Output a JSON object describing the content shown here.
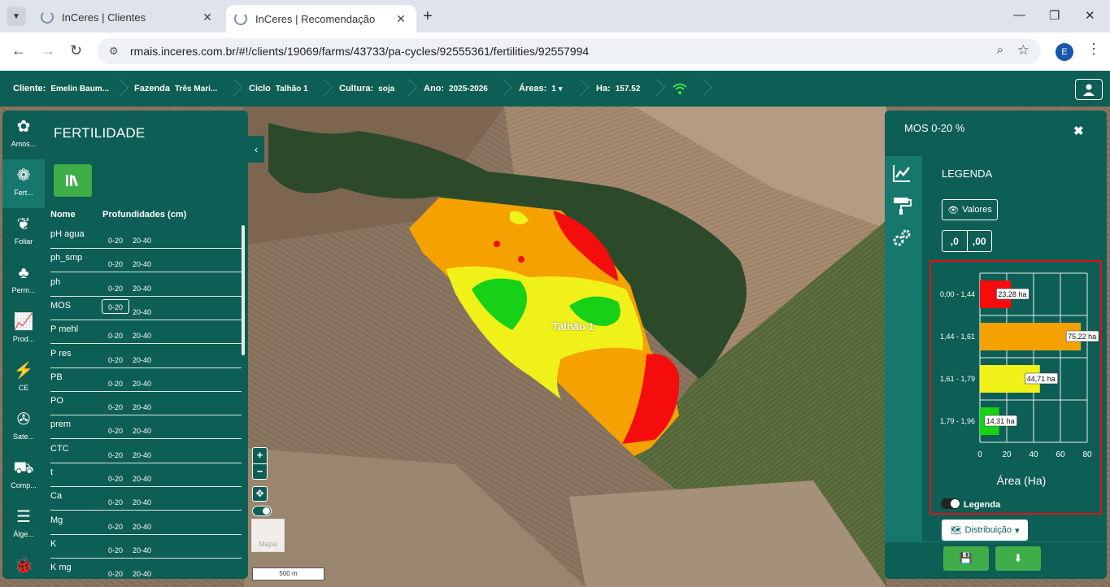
{
  "browser": {
    "tabs": [
      {
        "title": "InCeres | Clientes",
        "close": "✕"
      },
      {
        "title": "InCeres | Recomendação",
        "close": "✕"
      }
    ],
    "new_tab": "+",
    "url": "rmais.inceres.com.br/#!/clients/19069/farms/43733/pa-cycles/92555361/fertilities/92557994",
    "profile_initial": "E"
  },
  "header": {
    "cliente_label": "Cliente:",
    "cliente_value": "Emelin Baum...",
    "fazenda_label": "Fazenda",
    "fazenda_value": "Três Mari...",
    "ciclo_label": "Ciclo",
    "ciclo_value": "Talhão 1",
    "cultura_label": "Cultura:",
    "cultura_value": "soja",
    "ano_label": "Ano:",
    "ano_value": "2025-2026",
    "areas_label": "Áreas:",
    "areas_value": "1",
    "ha_label": "Ha:",
    "ha_value": "157.52"
  },
  "rail": [
    {
      "label": "Amos...",
      "icon": "samples-icon"
    },
    {
      "label": "Fert...",
      "icon": "fertility-icon"
    },
    {
      "label": "Foliar",
      "icon": "leaf-icon"
    },
    {
      "label": "Perm...",
      "icon": "permanent-crop-icon"
    },
    {
      "label": "Prod...",
      "icon": "productivity-icon"
    },
    {
      "label": "CE",
      "icon": "ce-icon"
    },
    {
      "label": "Sate...",
      "icon": "satellite-icon"
    },
    {
      "label": "Comp...",
      "icon": "composition-icon"
    },
    {
      "label": "Álge...",
      "icon": "layers-icon"
    },
    {
      "label": "",
      "icon": "bug-icon"
    }
  ],
  "fertility": {
    "title": "FERTILIDADE",
    "col_name": "Nome",
    "col_depth": "Profundidades (cm)",
    "rows": [
      {
        "name": "pH agua",
        "d1": "0-20",
        "d2": "20-40"
      },
      {
        "name": "ph_smp",
        "d1": "0-20",
        "d2": "20-40"
      },
      {
        "name": "ph",
        "d1": "0-20",
        "d2": "20-40"
      },
      {
        "name": "MOS",
        "d1": "0-20",
        "d2": "20-40"
      },
      {
        "name": "P mehl",
        "d1": "0-20",
        "d2": "20-40"
      },
      {
        "name": "P res",
        "d1": "0-20",
        "d2": "20-40"
      },
      {
        "name": "PB",
        "d1": "0-20",
        "d2": "20-40"
      },
      {
        "name": "PO",
        "d1": "0-20",
        "d2": "20-40"
      },
      {
        "name": "prem",
        "d1": "0-20",
        "d2": "20-40"
      },
      {
        "name": "CTC",
        "d1": "0-20",
        "d2": "20-40"
      },
      {
        "name": "t",
        "d1": "0-20",
        "d2": "20-40"
      },
      {
        "name": "Ca",
        "d1": "0-20",
        "d2": "20-40"
      },
      {
        "name": "Mg",
        "d1": "0-20",
        "d2": "20-40"
      },
      {
        "name": "K",
        "d1": "0-20",
        "d2": "20-40"
      },
      {
        "name": "K mg",
        "d1": "0-20",
        "d2": "20-40"
      }
    ]
  },
  "map": {
    "field_label": "Talhão 1",
    "zoom_in": "+",
    "zoom_out": "−",
    "basemap_label": "Mapa",
    "scale": "500 m"
  },
  "right_panel": {
    "title": "MOS 0-20 %",
    "legend_title": "LEGENDA",
    "valores_label": "Valores",
    "decimals_less": ",0",
    "decimals_more": ",00",
    "legend_toggle_label": "Legenda",
    "distribution_label": "Distribuição"
  },
  "chart_data": {
    "type": "bar",
    "orientation": "horizontal",
    "categories": [
      "0,00 - 1,44",
      "1,44 - 1,61",
      "1,61 - 1,79",
      "1,79 - 1,96"
    ],
    "values": [
      23.28,
      75.22,
      44.71,
      14.31
    ],
    "data_labels": [
      "23,28 ha",
      "75,22 ha",
      "44,71 ha",
      "14,31 ha"
    ],
    "colors": [
      "#f50d0d",
      "#f5a200",
      "#f1f11a",
      "#17d117"
    ],
    "xlabel": "Área (Ha)",
    "xlim": [
      0,
      80
    ],
    "xticks": [
      0,
      20,
      40,
      60,
      80
    ],
    "grid": true
  }
}
